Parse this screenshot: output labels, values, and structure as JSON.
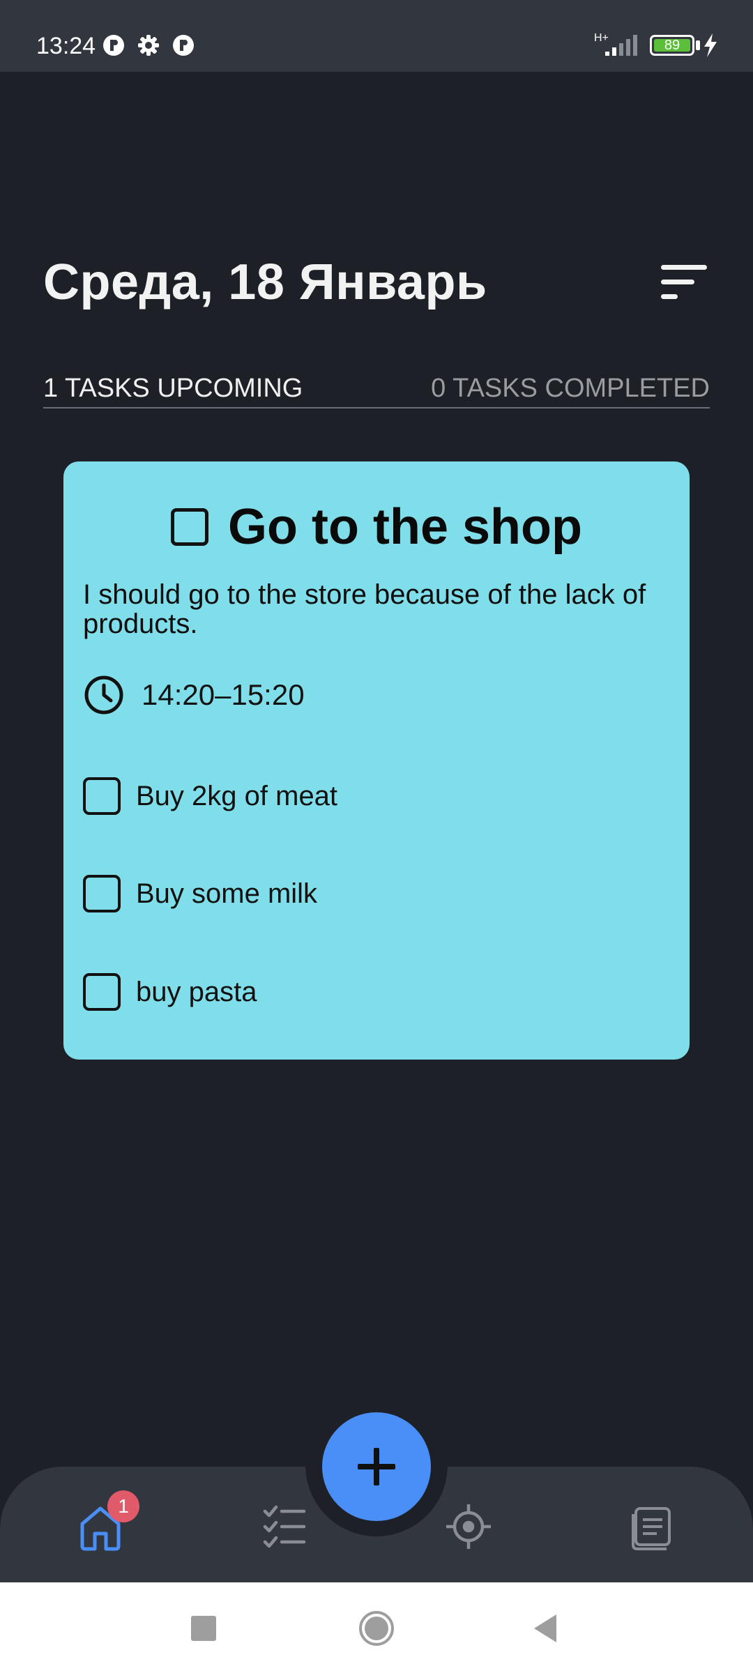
{
  "status_bar": {
    "time": "13:24",
    "network": "H+",
    "battery": "89"
  },
  "header": {
    "title": "Среда, 18 Январь"
  },
  "summary": {
    "upcoming": "1 TASKS UPCOMING",
    "completed": "0 TASKS COMPLETED"
  },
  "task": {
    "title": "Go to the shop",
    "description": "I should go to the store because of the lack of products.",
    "time": "14:20–15:20",
    "background_color": "#80deea",
    "subtasks": [
      {
        "label": "Buy 2kg of meat",
        "checked": false
      },
      {
        "label": "Buy some milk",
        "checked": false
      },
      {
        "label": "buy pasta",
        "checked": false
      }
    ]
  },
  "bottom_nav": {
    "items": [
      {
        "icon": "home-icon",
        "active": true,
        "badge": "1"
      },
      {
        "icon": "checklist-icon",
        "active": false
      },
      {
        "icon": "focus-target-icon",
        "active": false
      },
      {
        "icon": "notes-icon",
        "active": false
      }
    ],
    "fab_icon": "plus-icon",
    "accent_color": "#4a8ff8",
    "badge_color": "#e05a6a"
  },
  "system_nav": {
    "buttons": [
      "recents-square-icon",
      "home-circle-icon",
      "back-triangle-icon"
    ]
  }
}
